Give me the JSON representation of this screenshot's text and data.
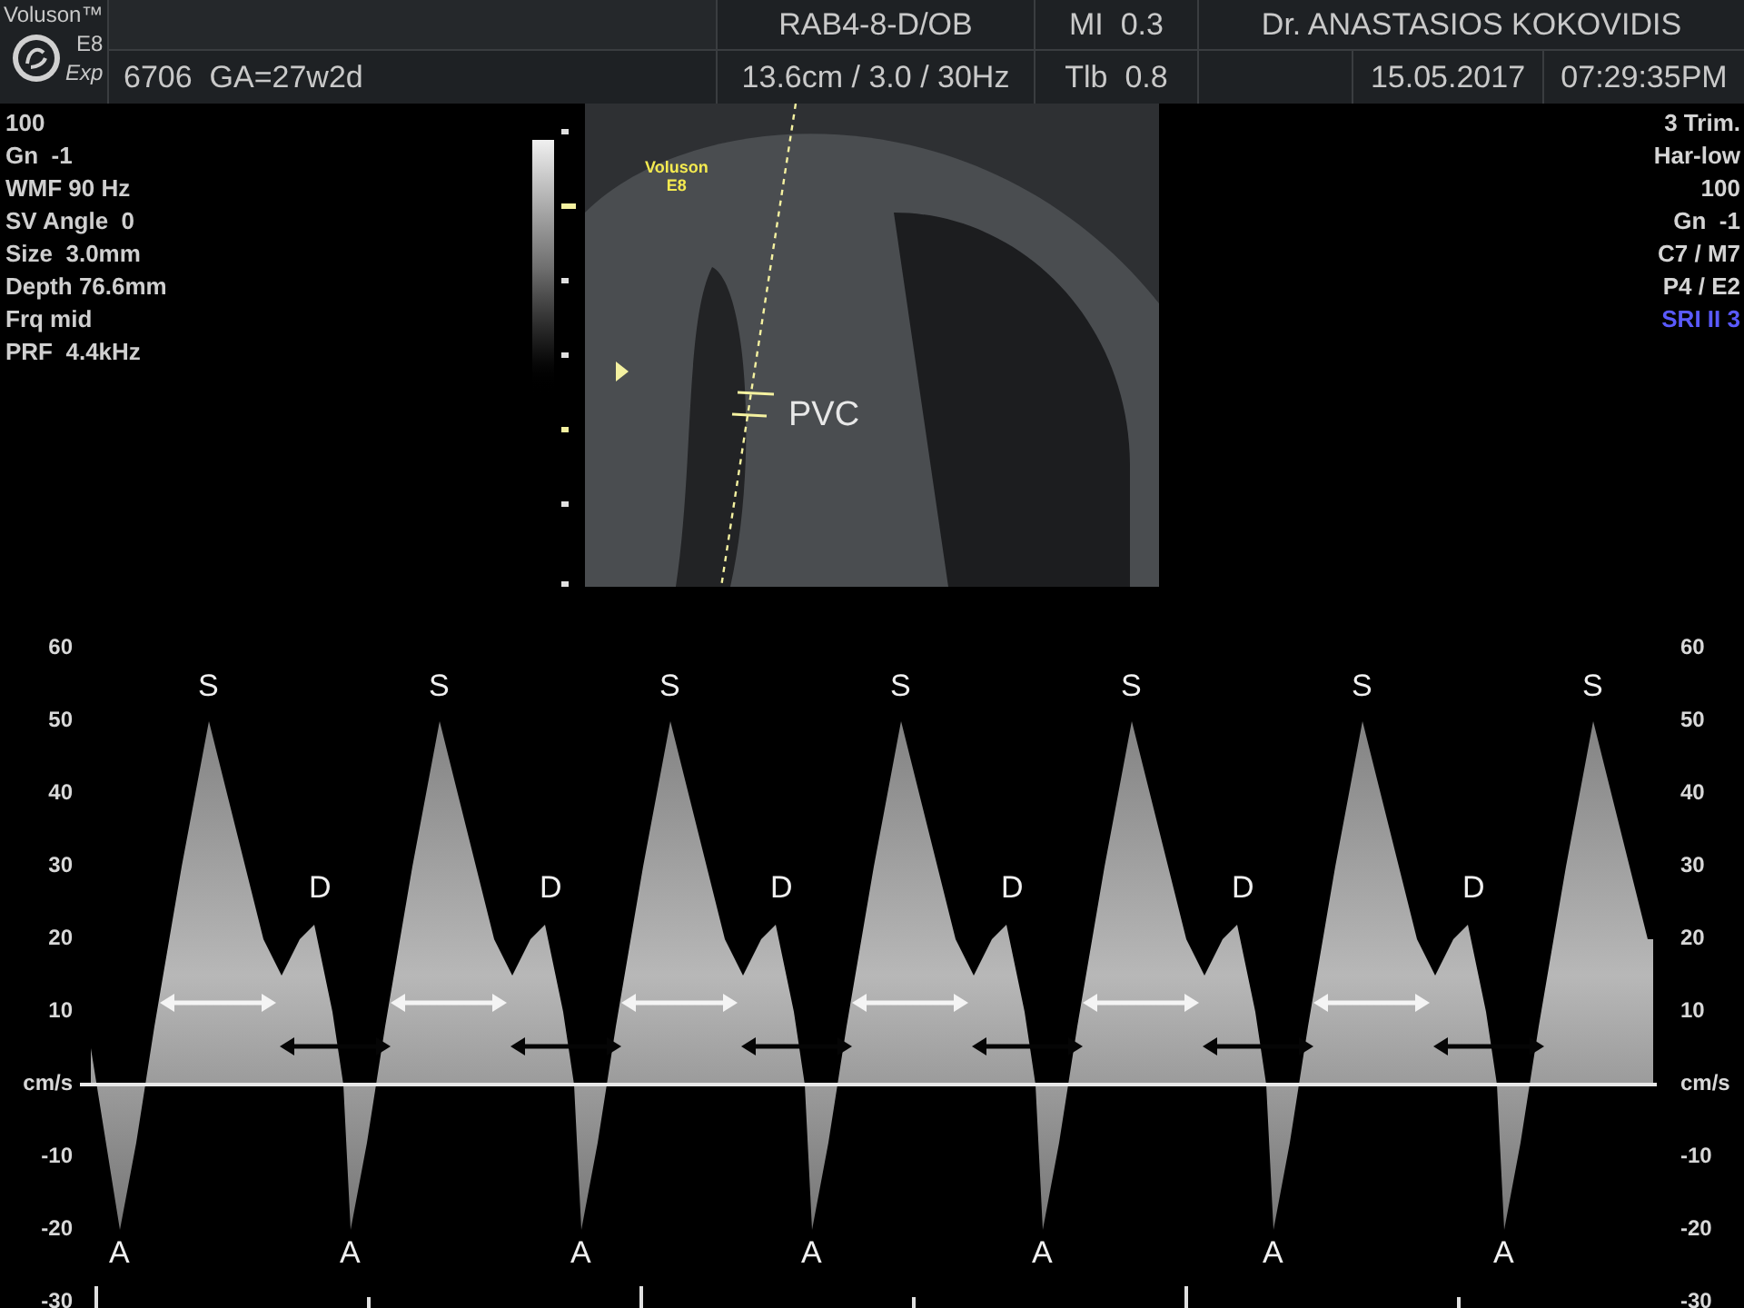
{
  "header": {
    "brand": "Voluson™",
    "model": "E8",
    "edition": "Exp",
    "patient": "6706  GA=27w2d",
    "probe": "RAB4-8-D/OB",
    "imaging": "13.6cm / 3.0 / 30Hz",
    "mi": "MI  0.3",
    "tib": "Tlb  0.8",
    "operator": "Dr. ANASTASIOS KOKOVIDIS",
    "date": "15.05.2017",
    "time": "07:29:35PM"
  },
  "left_params": [
    "100",
    "Gn  -1",
    "WMF 90 Hz",
    "SV Angle  0",
    "Size  3.0mm",
    "Depth 76.6mm",
    "Frq mid",
    "PRF  4.4kHz"
  ],
  "right_params": [
    {
      "text": "3 Trim.",
      "color": "#d4d4d4"
    },
    {
      "text": "Har-low",
      "color": "#d4d4d4"
    },
    {
      "text": "100",
      "color": "#d4d4d4"
    },
    {
      "text": "Gn  -1",
      "color": "#d4d4d4"
    },
    {
      "text": "C7 / M7",
      "color": "#d4d4d4"
    },
    {
      "text": "P4 / E2",
      "color": "#d4d4d4"
    },
    {
      "text": "SRI II 3",
      "color": "#5a5aff"
    }
  ],
  "image": {
    "logo_brand": "Voluson",
    "logo_model": "E8",
    "structure_label": "PVC"
  },
  "doppler": {
    "left_axis": [
      "60",
      "50",
      "40",
      "30",
      "20",
      "10",
      "cm/s",
      "-10",
      "-20",
      "-30"
    ],
    "right_axis": [
      "60",
      "50",
      "40",
      "30",
      "20",
      "10",
      "cm/s",
      "-10",
      "-20",
      "-30"
    ],
    "systolic_labels": [
      "S",
      "S",
      "S",
      "S",
      "S",
      "S",
      "S"
    ],
    "diastolic_labels": [
      "D",
      "D",
      "D",
      "D",
      "D",
      "D"
    ],
    "atrial_labels": [
      "A",
      "A",
      "A",
      "A",
      "A",
      "A",
      "A"
    ]
  }
}
